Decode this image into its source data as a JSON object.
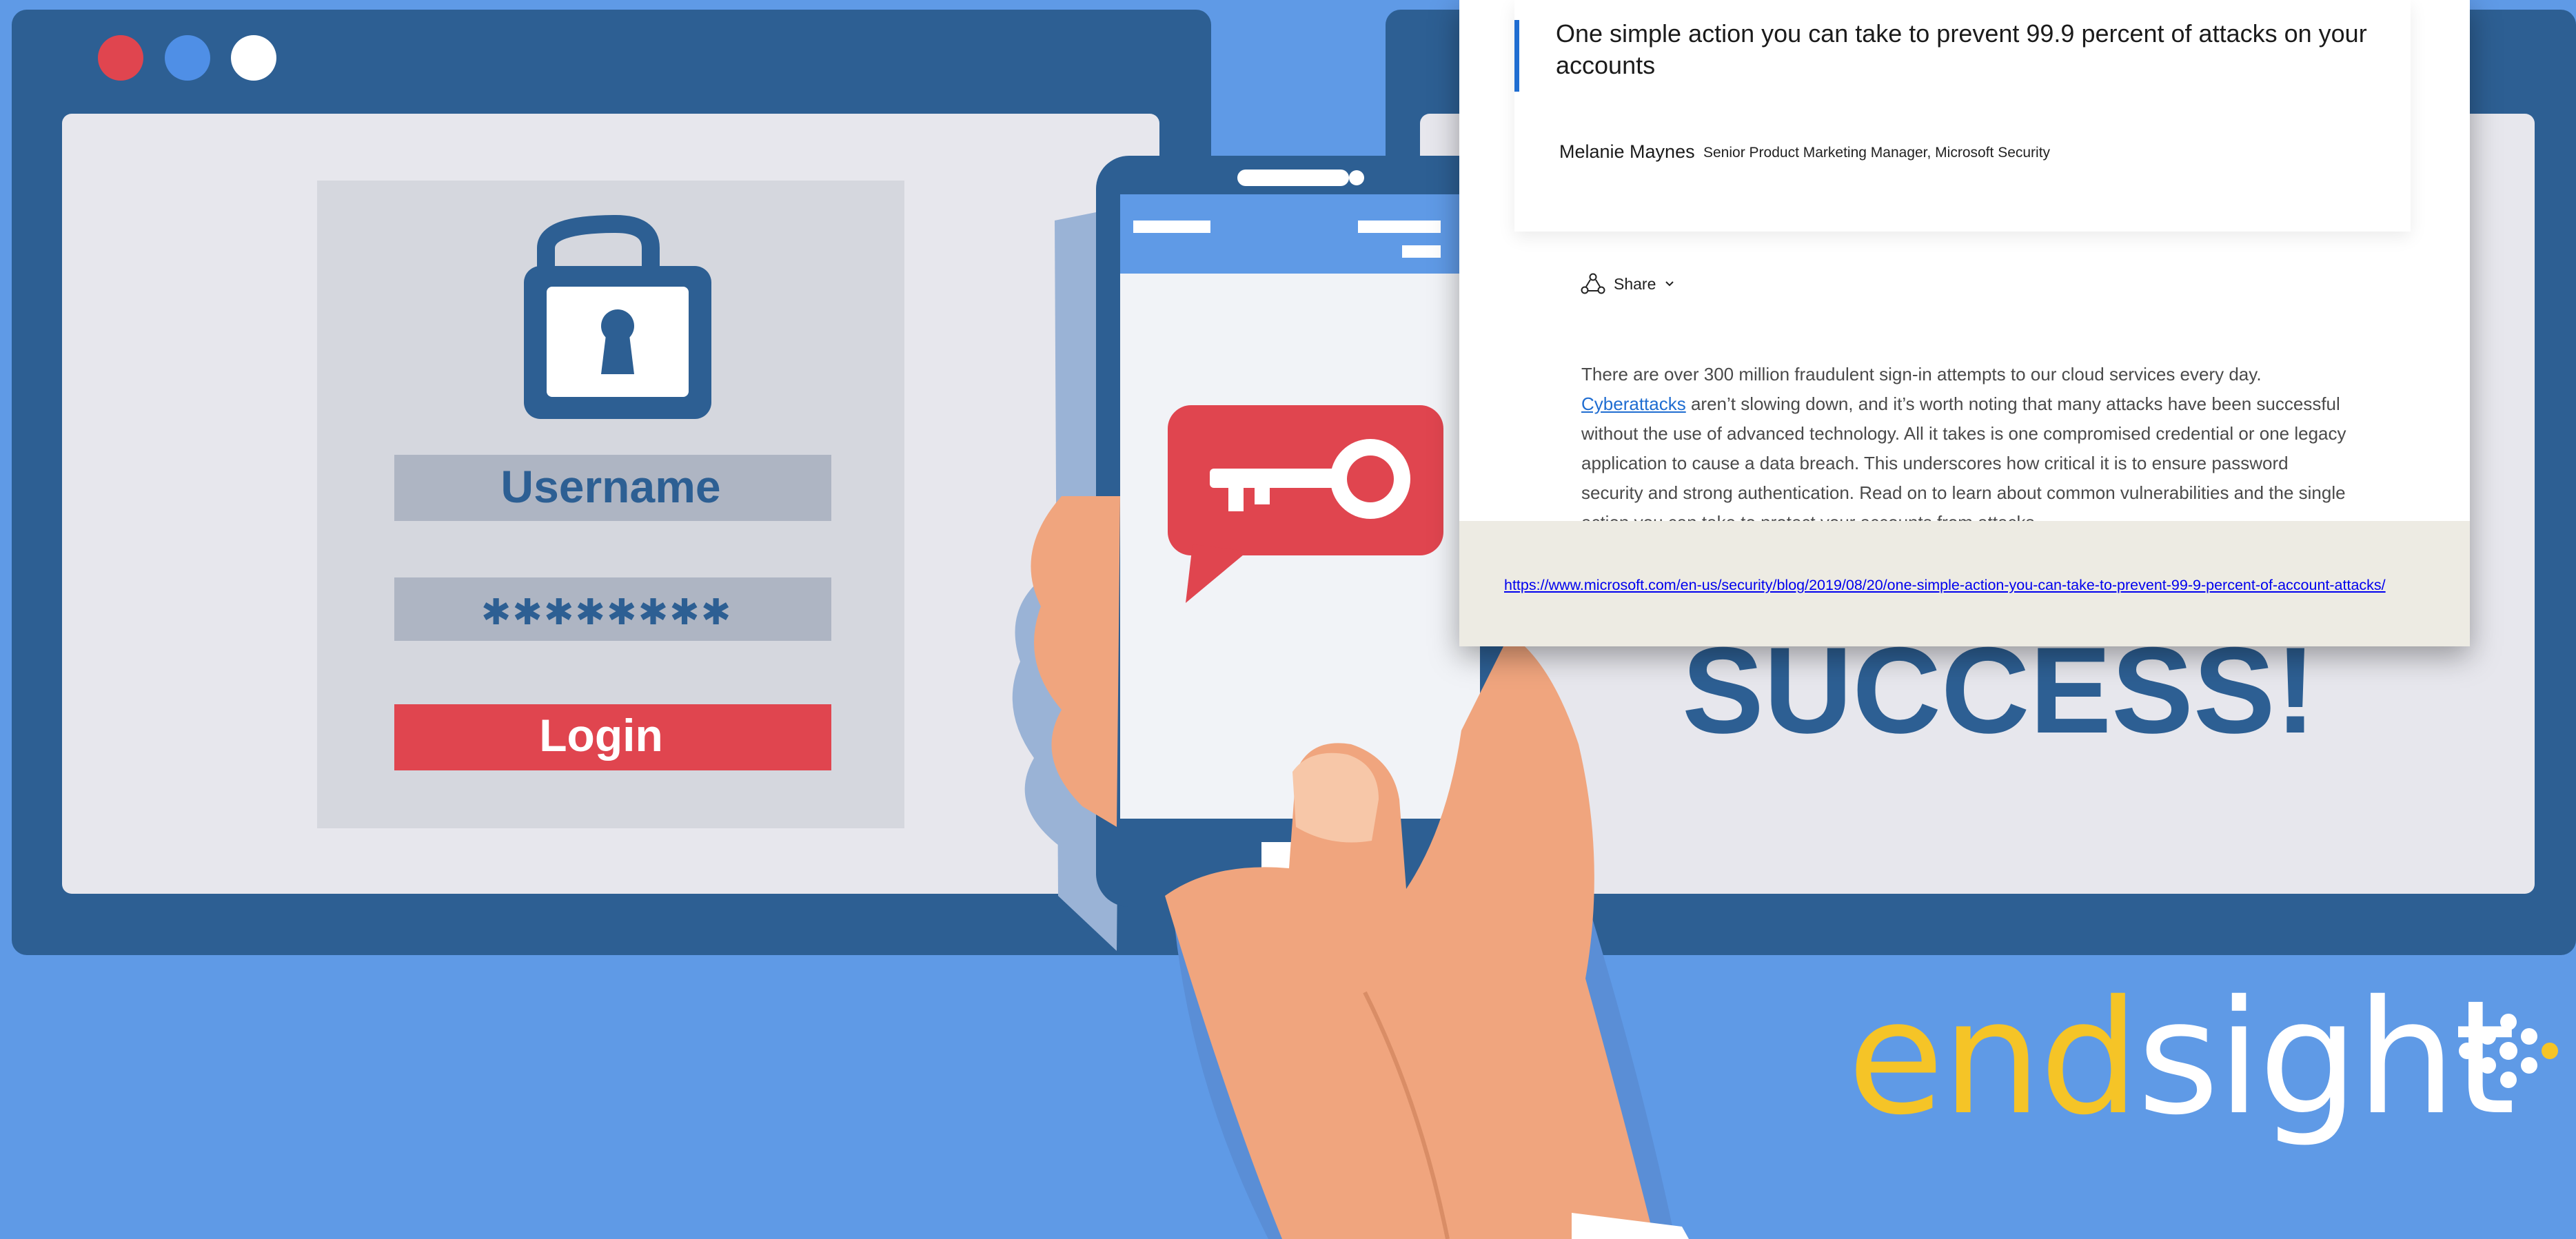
{
  "background": {
    "window_dots": [
      "#e0454f",
      "#4f8fe6",
      "#ffffff"
    ],
    "login_form": {
      "username_label": "Username",
      "password_mask": "✱✱✱✱✱✱✱✱",
      "login_label": "Login"
    },
    "success_text": "SUCCESS!"
  },
  "article": {
    "title": "One simple action you can take to prevent 99.9 percent of attacks on your accounts",
    "author_name": "Melanie Maynes",
    "author_role": "Senior Product Marketing Manager, Microsoft Security",
    "share_label": "Share",
    "body_start": "There are over 300 million fraudulent sign-in attempts to our cloud services every day. ",
    "body_link": "Cyberattacks",
    "body_rest": " aren’t slowing down, and it’s worth noting that many attacks have been successful without the use of advanced technology. All it takes is one compromised credential or one legacy application to cause a data breach. This underscores how critical it is to ensure password security and strong authentication. Read on to learn about common vulnerabilities and the single action you can take to protect your accounts from attacks.",
    "url": "https://www.microsoft.com/en-us/security/blog/2019/08/20/one-simple-action-you-can-take-to-prevent-99-9-percent-of-account-attacks/"
  },
  "brand": {
    "part1": "end",
    "part2": "sight",
    "accent_color": "#f5c427"
  }
}
